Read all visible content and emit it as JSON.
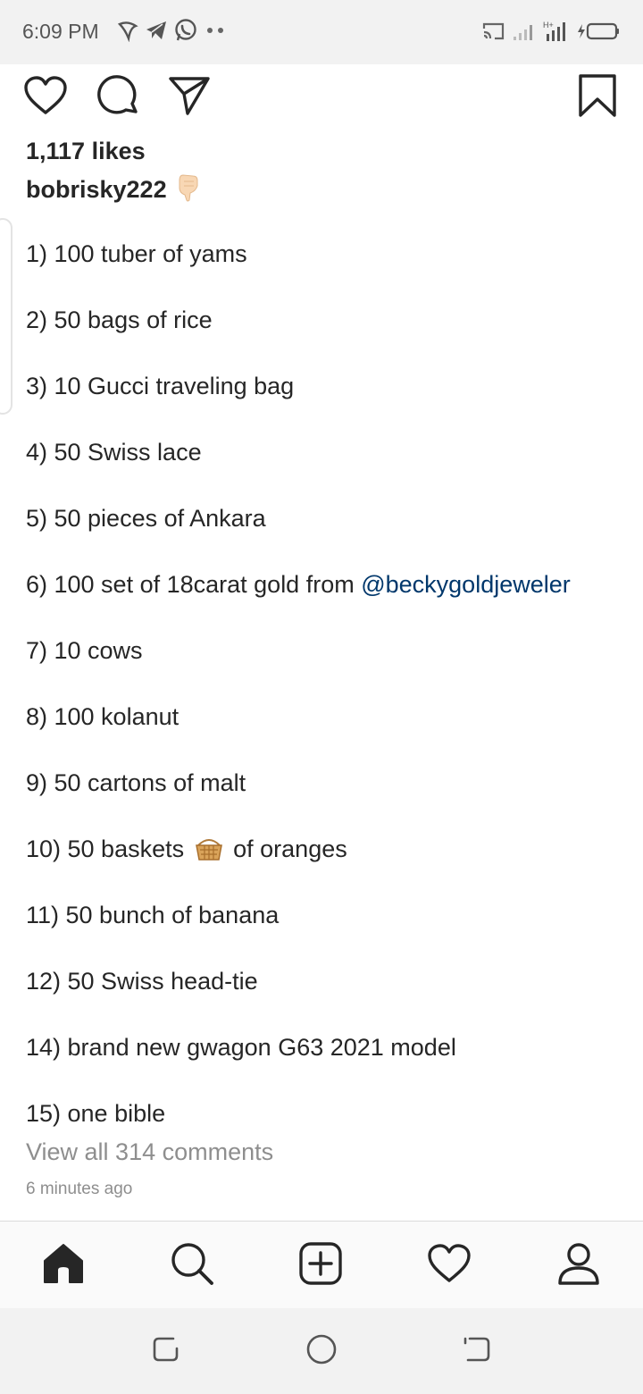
{
  "status_bar": {
    "time": "6:09 PM",
    "left_icons": [
      "app-notification-icon",
      "telegram-icon",
      "whatsapp-icon",
      "more-dots-icon"
    ],
    "right_icons": [
      "cast-icon",
      "signal-icon",
      "signal-hplus-icon",
      "battery-charging-icon"
    ]
  },
  "post": {
    "actions": [
      "heart-icon",
      "comment-icon",
      "share-icon",
      "bookmark-icon"
    ],
    "likes": "1,117 likes",
    "username": "bobrisky222",
    "username_emoji": "👇🏻",
    "caption_items": [
      {
        "text": "1) 100 tuber of yams"
      },
      {
        "text": "2) 50 bags of rice"
      },
      {
        "text": "3) 10 Gucci traveling bag"
      },
      {
        "text": "4) 50 Swiss lace"
      },
      {
        "text": "5) 50 pieces of Ankara"
      },
      {
        "text": "6) 100 set of 18carat gold from ",
        "mention": "@beckygoldjeweler"
      },
      {
        "text": "7) 10 cows"
      },
      {
        "text": "8) 100 kolanut"
      },
      {
        "text": "9) 50 cartons of malt"
      },
      {
        "text_before": "10) 50 baskets",
        "emoji": "basket-icon",
        "text_after": "of oranges"
      },
      {
        "text": "11) 50 bunch of banana"
      },
      {
        "text": "12) 50 Swiss head-tie"
      },
      {
        "text": "14) brand new gwagon G63 2021 model"
      },
      {
        "text": "15) one bible"
      }
    ],
    "view_comments": "View all 314 comments",
    "timestamp": "6 minutes ago"
  },
  "bottom_nav": [
    "home-icon",
    "search-icon",
    "add-post-icon",
    "activity-heart-icon",
    "profile-icon"
  ],
  "system_nav": [
    "recent-apps-icon",
    "home-circle-icon",
    "back-icon"
  ],
  "colors": {
    "text": "#262626",
    "muted": "#8e8e8e",
    "mention": "#00376b",
    "status_bar_bg": "#f2f2f2",
    "nav_bg": "#fafafa"
  }
}
